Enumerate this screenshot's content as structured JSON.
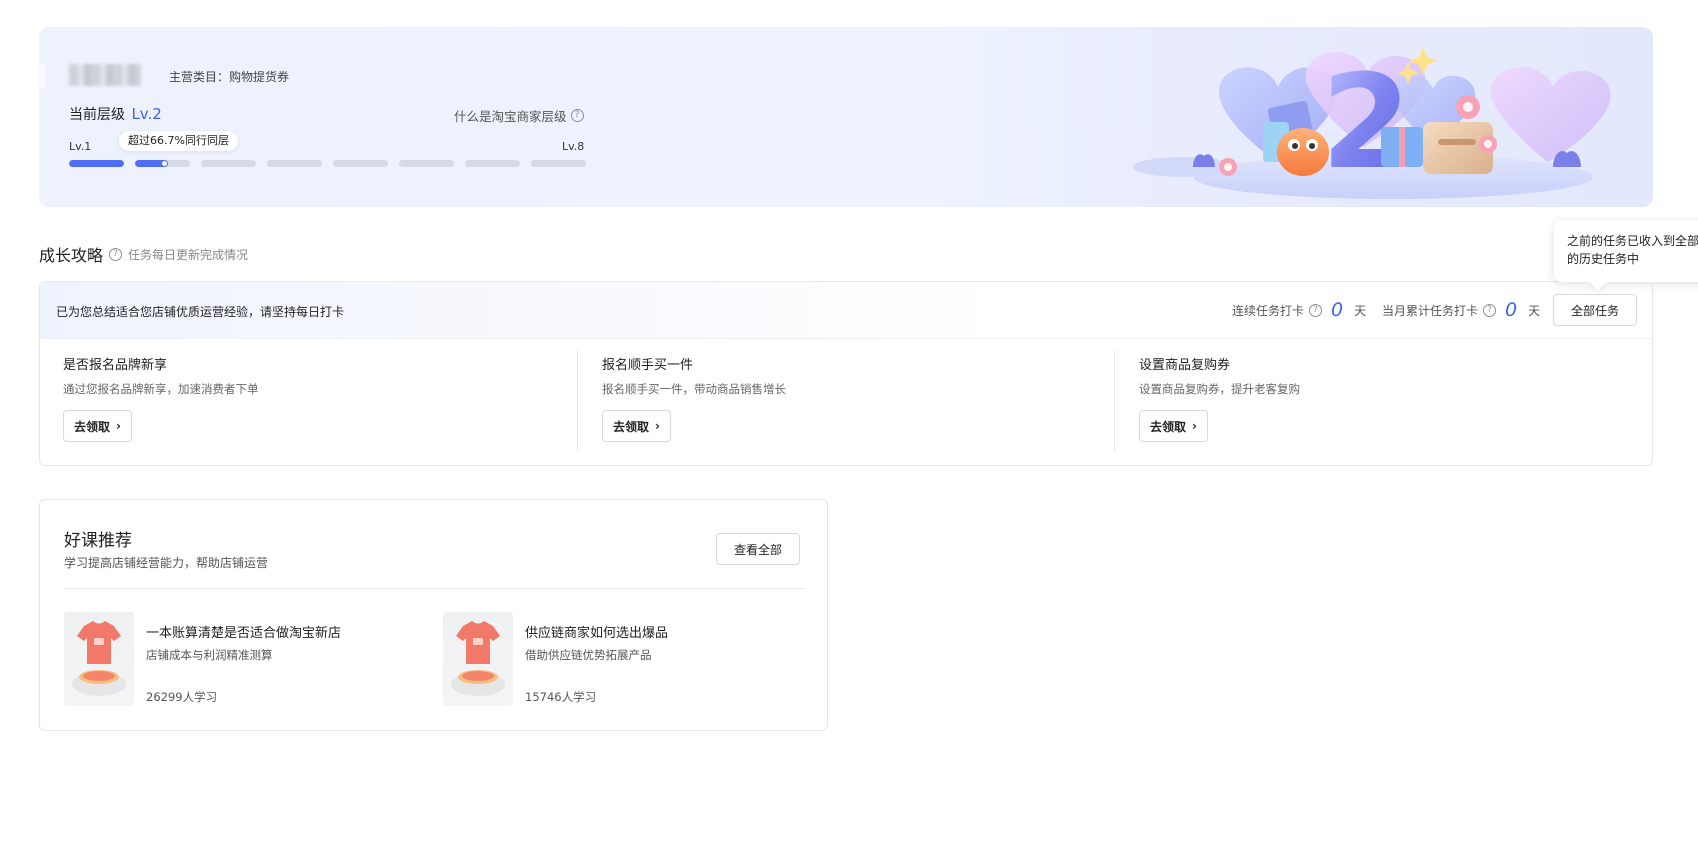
{
  "banner": {
    "category": "主营类目：购物提货券",
    "level_prefix": "当前层级",
    "level": "Lv.2",
    "what_level": "什么是淘宝商家层级",
    "level_start": "Lv.1",
    "level_end": "Lv.8",
    "beat_tip": "超过66.7%同行同层",
    "progress_levels": [
      {
        "fill": 1.0
      },
      {
        "fill": 0.6
      },
      {
        "fill": 0
      },
      {
        "fill": 0
      },
      {
        "fill": 0
      },
      {
        "fill": 0
      },
      {
        "fill": 0
      },
      {
        "fill": 0
      }
    ],
    "illustration_number": "2"
  },
  "growth": {
    "title": "成长攻略",
    "subtitle": "任务每日更新完成情况",
    "tooltip": "之前的任务已收入到全部的历史任务中",
    "hint": "已为您总结适合您店铺优质运营经验，请坚持每日打卡",
    "streak_label": "连续任务打卡",
    "streak_value": "0",
    "streak_unit": "天",
    "month_label": "当月累计任务打卡",
    "month_value": "0",
    "month_unit": "天",
    "all_tasks_label": "全部任务",
    "tasks": [
      {
        "title": "是否报名品牌新享",
        "desc": "通过您报名品牌新享，加速消费者下单",
        "button": "去领取"
      },
      {
        "title": "报名顺手买一件",
        "desc": "报名顺手买一件，带动商品销售增长",
        "button": "去领取"
      },
      {
        "title": "设置商品复购券",
        "desc": "设置商品复购券，提升老客复购",
        "button": "去领取"
      }
    ]
  },
  "courses": {
    "title": "好课推荐",
    "subtitle": "学习提高店铺经营能力，帮助店铺运营",
    "view_all": "查看全部",
    "items": [
      {
        "title": "一本账算清楚是否适合做淘宝新店",
        "desc": "店铺成本与利润精准测算",
        "learners": "26299人学习"
      },
      {
        "title": "供应链商家如何选出爆品",
        "desc": "借助供应链优势拓展产品",
        "learners": "15746人学习"
      }
    ]
  },
  "colors": {
    "accent": "#3d63f5",
    "progress_fill": "#4f6ef7",
    "progress_track": "#d5dae6"
  }
}
